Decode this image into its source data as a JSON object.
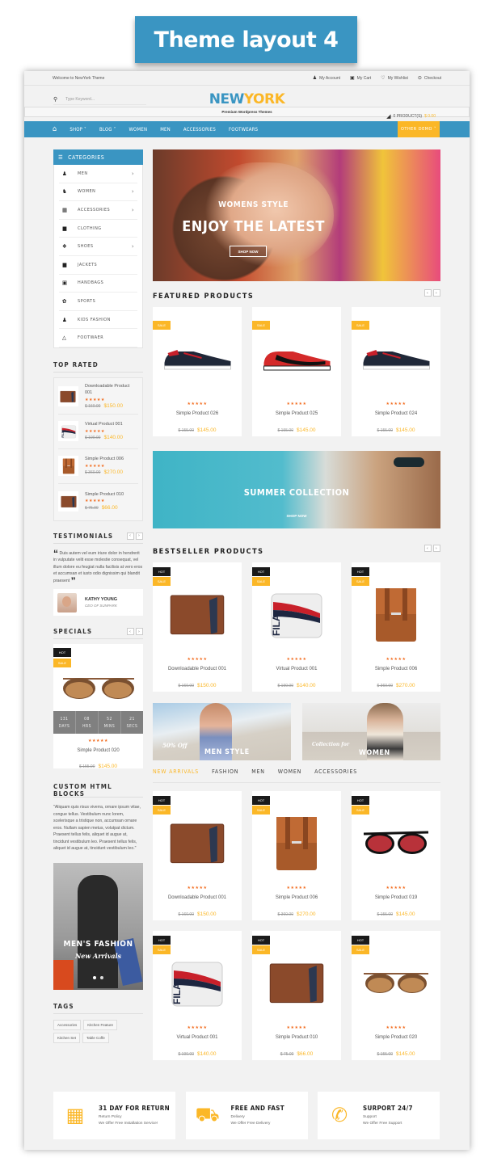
{
  "banner_title": "Theme layout 4",
  "topbar": {
    "welcome": "Welcome to NewYork Theme",
    "links": [
      {
        "label": "My Account",
        "icon": "user-icon"
      },
      {
        "label": "My Cart",
        "icon": "bag-icon"
      },
      {
        "label": "My Wishlist",
        "icon": "heart-icon"
      },
      {
        "label": "Checkout",
        "icon": "check-circle-icon"
      }
    ]
  },
  "header": {
    "search_placeholder": "Type Keyword...",
    "logo_part1": "NEW",
    "logo_part2": "YORK",
    "logo_tagline": "Premium Wordpress Themes",
    "cart_count": "0 PRODUCT(S)",
    "cart_total": "$ 0.00"
  },
  "nav": {
    "items": [
      "SHOP",
      "BLOG",
      "WOMEN",
      "MEN",
      "ACCESSORIES",
      "FOOTWEARS"
    ],
    "other": "OTHER DEMO"
  },
  "colors": {
    "accent": "#3a95c2",
    "highlight": "#fbb727",
    "star": "#f26b1d"
  },
  "sidebar": {
    "categories_title": "CATEGORIES",
    "categories": [
      {
        "label": "MEN",
        "icon": "man-icon",
        "has_sub": true
      },
      {
        "label": "WOMEN",
        "icon": "woman-icon",
        "has_sub": true
      },
      {
        "label": "ACCESSORIES",
        "icon": "accessories-icon",
        "has_sub": true
      },
      {
        "label": "CLOTHING",
        "icon": "tshirt-icon",
        "has_sub": false
      },
      {
        "label": "SHOES",
        "icon": "shoes-icon",
        "has_sub": true
      },
      {
        "label": "JACKETS",
        "icon": "jacket-icon",
        "has_sub": false
      },
      {
        "label": "HANDBAGS",
        "icon": "handbag-icon",
        "has_sub": false
      },
      {
        "label": "SPORTS",
        "icon": "sports-icon",
        "has_sub": false
      },
      {
        "label": "KIDS FASHION",
        "icon": "kid-icon",
        "has_sub": false
      },
      {
        "label": "FOOTWAER",
        "icon": "hanger-icon",
        "has_sub": false
      }
    ],
    "top_rated_title": "TOP RATED",
    "top_rated": [
      {
        "name": "Downloadable Product 001",
        "old": "$ 160.00",
        "price": "$150.00"
      },
      {
        "name": "Virtual Product 001",
        "old": "$ 190.00",
        "price": "$140.00"
      },
      {
        "name": "Simple Product 006",
        "old": "$ 360.00",
        "price": "$270.00"
      },
      {
        "name": "Simple Product 010",
        "old": "$ 75.00",
        "price": "$66.00"
      }
    ],
    "testimonials_title": "TESTIMONIALS",
    "testimonial_text": "Duis autem vel eum iriure dolor in hendrerit in vulputate velit esse molestie consequat, vel illum dolore eu feugiat nulla facilisis at vero eros et accumsan et iusto odio dignissim qui blandit praesent",
    "testimonial_author": "KATHY YOUNG",
    "testimonial_role": "CEO OF SUNPARK",
    "specials_title": "SPECIALS",
    "special": {
      "badge_hot": "HOT",
      "badge_sale": "SALE",
      "countdown": [
        {
          "value": "131",
          "unit": "DAYS"
        },
        {
          "value": "08",
          "unit": "HRS"
        },
        {
          "value": "52",
          "unit": "MINS"
        },
        {
          "value": "21",
          "unit": "SECS"
        }
      ],
      "name": "Simple Product 020",
      "old": "$ 155.00",
      "price": "$145.00"
    },
    "custom_title": "CUSTOM HTML BLOCKS",
    "custom_text": "\"Aliquam quis risus viverra, ornare ipsum vitae, congue tellus. Vestibulum nunc lorem, scelerisque a tristique non, accumsan ornare eros. Nullam sapien metus, volutpat dictum. Praesent tellus felis, aliquet id augue at, tincidunt vestibulum leo. Praesent tellus felis, aliquet id augue at, tincidunt vestibulum leo.\"",
    "promo_title": "MEN'S FASHION",
    "promo_sub": "New Arrivals",
    "tags_title": "TAGS",
    "tags": [
      "Accessories",
      "Kitchen Feature",
      "Kitchen Set",
      "Table Coffe"
    ]
  },
  "hero": {
    "line1": "WOMENS STYLE",
    "line2": "ENJOY THE LATEST",
    "button": "SHOP NOW"
  },
  "featured": {
    "title": "FEATURED PRODUCTS",
    "items": [
      {
        "name": "Simple Product 026",
        "old": "$ 155.00",
        "price": "$145.00",
        "badges": [
          "SALE"
        ],
        "img": "shoe-dark"
      },
      {
        "name": "Simple Product 025",
        "old": "$ 155.00",
        "price": "$145.00",
        "badges": [
          "SALE"
        ],
        "img": "shoe-red"
      },
      {
        "name": "Simple Product 024",
        "old": "$ 155.00",
        "price": "$145.00",
        "badges": [
          "SALE"
        ],
        "img": "shoe-dark"
      }
    ]
  },
  "summer": {
    "title": "SUMMER COLLECTION",
    "button": "SHOP NOW"
  },
  "bestseller": {
    "title": "BESTSELLER PRODUCTS",
    "items": [
      {
        "name": "Downloadable Product 001",
        "old": "$ 160.00",
        "price": "$150.00",
        "badges": [
          "HOT",
          "SALE"
        ],
        "img": "wallet"
      },
      {
        "name": "Virtual Product 001",
        "old": "$ 190.00",
        "price": "$140.00",
        "badges": [
          "HOT",
          "SALE"
        ],
        "img": "fila-bag"
      },
      {
        "name": "Simple Product 006",
        "old": "$ 360.00",
        "price": "$270.00",
        "badges": [
          "HOT",
          "SALE"
        ],
        "img": "brown-bag"
      }
    ]
  },
  "banners": [
    {
      "script": "50% Off",
      "title": "MEN STYLE"
    },
    {
      "script": "Collection for",
      "title": "WOMEN"
    }
  ],
  "tabs": {
    "items": [
      "NEW ARRIVALS",
      "FASHION",
      "MEN",
      "WOMEN",
      "ACCESSORIES"
    ],
    "active": 0
  },
  "new_arrivals": {
    "items": [
      {
        "name": "Downloadable Product 001",
        "old": "$ 160.00",
        "price": "$150.00",
        "badges": [
          "HOT",
          "SALE"
        ],
        "img": "wallet"
      },
      {
        "name": "Simple Product 006",
        "old": "$ 360.00",
        "price": "$270.00",
        "badges": [
          "HOT",
          "SALE"
        ],
        "img": "brown-bag"
      },
      {
        "name": "Simple Product 019",
        "old": "$ 155.00",
        "price": "$145.00",
        "badges": [
          "HOT",
          "SALE"
        ],
        "img": "sunglasses-red"
      },
      {
        "name": "Virtual Product 001",
        "old": "$ 190.00",
        "price": "$140.00",
        "badges": [
          "HOT",
          "SALE"
        ],
        "img": "fila-bag"
      },
      {
        "name": "Simple Product 010",
        "old": "$ 75.00",
        "price": "$66.00",
        "badges": [
          "HOT",
          "SALE"
        ],
        "img": "wallet"
      },
      {
        "name": "Simple Product 020",
        "old": "$ 155.00",
        "price": "$145.00",
        "badges": [
          "HOT",
          "SALE"
        ],
        "img": "sunglasses-brown"
      }
    ]
  },
  "features": [
    {
      "title": "31 DAY FOR RETURN",
      "sub": "Return Policy",
      "desc": "We Offer Free Installation Service!",
      "icon": "calendar-icon"
    },
    {
      "title": "FREE AND FAST",
      "sub": "Delivery",
      "desc": "We Offer Free Delivery",
      "icon": "truck-icon"
    },
    {
      "title": "SURPORT 24/7",
      "sub": "Support",
      "desc": "We Offer Free Support",
      "icon": "phone-icon"
    }
  ]
}
